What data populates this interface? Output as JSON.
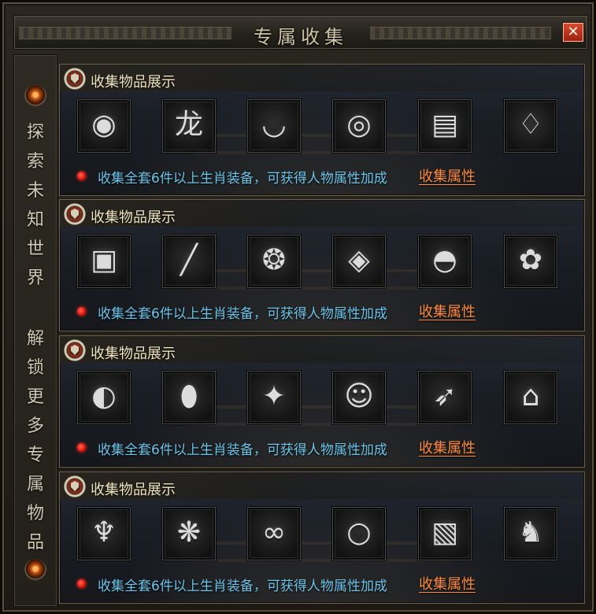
{
  "window": {
    "title": "专属收集",
    "close_label": "✕"
  },
  "sidebar": {
    "text_top": [
      "探",
      "索",
      "未",
      "知",
      "世",
      "界"
    ],
    "text_bottom": [
      "解",
      "锁",
      "更",
      "多",
      "专",
      "属",
      "物",
      "品"
    ]
  },
  "panels": [
    {
      "title": "收集物品展示",
      "description": "收集全套6件以上生肖装备，可获得人物属性加成",
      "link": "收集属性",
      "items": [
        {
          "icon": "mooncake-icon",
          "glyph": "◉"
        },
        {
          "icon": "dragon-orb-icon",
          "glyph": "龙"
        },
        {
          "icon": "mortar-bowl-icon",
          "glyph": "◡"
        },
        {
          "icon": "silver-coin-icon",
          "glyph": "◎"
        },
        {
          "icon": "ingot-box-icon",
          "glyph": "▤"
        },
        {
          "icon": "pouch-icon",
          "glyph": "♢"
        }
      ]
    },
    {
      "title": "收集物品展示",
      "description": "收集全套6件以上生肖装备，可获得人物属性加成",
      "link": "收集属性",
      "items": [
        {
          "icon": "treasure-chest-icon",
          "glyph": "▣"
        },
        {
          "icon": "needle-icon",
          "glyph": "╱"
        },
        {
          "icon": "spirit-beast-icon",
          "glyph": "❂"
        },
        {
          "icon": "jade-token-icon",
          "glyph": "◈"
        },
        {
          "icon": "dumpling-icon",
          "glyph": "◓"
        },
        {
          "icon": "flower-cluster-icon",
          "glyph": "✿"
        }
      ]
    },
    {
      "title": "收集物品展示",
      "description": "收集全套6件以上生肖装备，可获得人物属性加成",
      "link": "收集属性",
      "items": [
        {
          "icon": "dragon-egg-icon",
          "glyph": "◐"
        },
        {
          "icon": "cocoon-icon",
          "glyph": "⬮"
        },
        {
          "icon": "bat-icon",
          "glyph": "✦"
        },
        {
          "icon": "mask-icon",
          "glyph": "☺"
        },
        {
          "icon": "horn-icon",
          "glyph": "➶"
        },
        {
          "icon": "bell-icon",
          "glyph": "⌂"
        }
      ]
    },
    {
      "title": "收集物品展示",
      "description": "收集全套6件以上生肖装备，可获得人物属性加成",
      "link": "收集属性",
      "items": [
        {
          "icon": "staff-head-icon",
          "glyph": "♆"
        },
        {
          "icon": "phoenix-icon",
          "glyph": "❋"
        },
        {
          "icon": "chain-icon",
          "glyph": "∞"
        },
        {
          "icon": "ring-icon",
          "glyph": "○"
        },
        {
          "icon": "scroll-tablet-icon",
          "glyph": "▧"
        },
        {
          "icon": "kirin-statue-icon",
          "glyph": "♞"
        }
      ]
    }
  ]
}
